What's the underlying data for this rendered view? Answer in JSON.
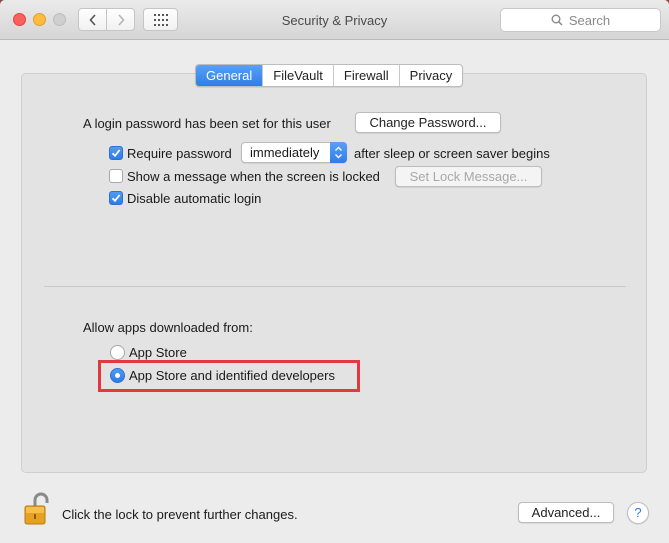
{
  "window": {
    "title": "Security & Privacy"
  },
  "search": {
    "placeholder": "Search"
  },
  "tabs": [
    {
      "label": "General",
      "active": true
    },
    {
      "label": "FileVault",
      "active": false
    },
    {
      "label": "Firewall",
      "active": false
    },
    {
      "label": "Privacy",
      "active": false
    }
  ],
  "general": {
    "login_password_text": "A login password has been set for this user",
    "change_password_button": "Change Password...",
    "require_password_label": "Require password",
    "require_password_checked": true,
    "require_password_delay": "immediately",
    "after_sleep_text": "after sleep or screen saver begins",
    "show_message_label": "Show a message when the screen is locked",
    "show_message_checked": false,
    "set_lock_message_button": "Set Lock Message...",
    "disable_auto_login_label": "Disable automatic login",
    "disable_auto_login_checked": true
  },
  "allow_apps": {
    "heading": "Allow apps downloaded from:",
    "options": [
      {
        "label": "App Store",
        "selected": false
      },
      {
        "label": "App Store and identified developers",
        "selected": true
      }
    ]
  },
  "footer": {
    "lock_text": "Click the lock to prevent further changes.",
    "advanced_button": "Advanced...",
    "help_label": "?"
  },
  "colors": {
    "accent": "#2e7ee6",
    "highlight": "#e2383f"
  },
  "icons": [
    "close-icon",
    "minimize-icon",
    "zoom-icon",
    "chevron-left-icon",
    "chevron-right-icon",
    "grid-icon",
    "search-icon",
    "checkmark-icon",
    "padlock-open-icon"
  ]
}
